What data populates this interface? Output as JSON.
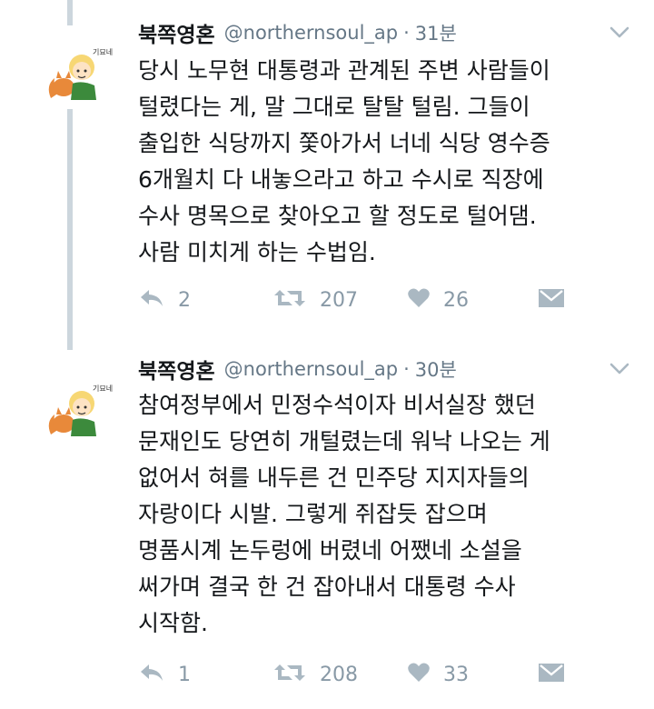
{
  "tweets": [
    {
      "author_name": "북쪽영혼",
      "handle": "@northernsoul_ap",
      "separator": "·",
      "time": "31분",
      "lines": [
        "당시 노무현 대통령과 관계된 주변 사람들이",
        "털렸다는 게,  말 그대로 탈탈 털림. 그들이",
        "출입한 식당까지 쫓아가서 너네 식당 영수증",
        "6개월치 다 내놓으라고 하고 수시로 직장에",
        "수사 명목으로 찾아오고 할 정도로 털어댐.",
        "사람 미치게 하는 수법임."
      ],
      "reply_count": "2",
      "retweet_count": "207",
      "like_count": "26"
    },
    {
      "author_name": "북쪽영혼",
      "handle": "@northernsoul_ap",
      "separator": "·",
      "time": "30분",
      "lines": [
        "참여정부에서 민정수석이자 비서실장 했던",
        "문재인도 당연히 개털렸는데 워낙 나오는 게",
        "없어서 혀를 내두른 건 민주당 지지자들의",
        "자랑이다 시발. 그렇게 쥐잡듯 잡으며",
        "명품시계 논두렁에 버렸네 어쨌네 소설을",
        "써가며 결국 한 건 잡아내서 대통령 수사",
        "시작함."
      ],
      "reply_count": "1",
      "retweet_count": "208",
      "like_count": "33"
    }
  ],
  "icons": {
    "reply": "reply-icon",
    "retweet": "retweet-icon",
    "like": "heart-icon",
    "dm": "envelope-icon",
    "more": "chevron-down-icon"
  },
  "avatar_text": "기묘네",
  "colors": {
    "icon_gray": "#aab8c2",
    "text_gray": "#657786",
    "thread_line": "#ccd6dd"
  }
}
